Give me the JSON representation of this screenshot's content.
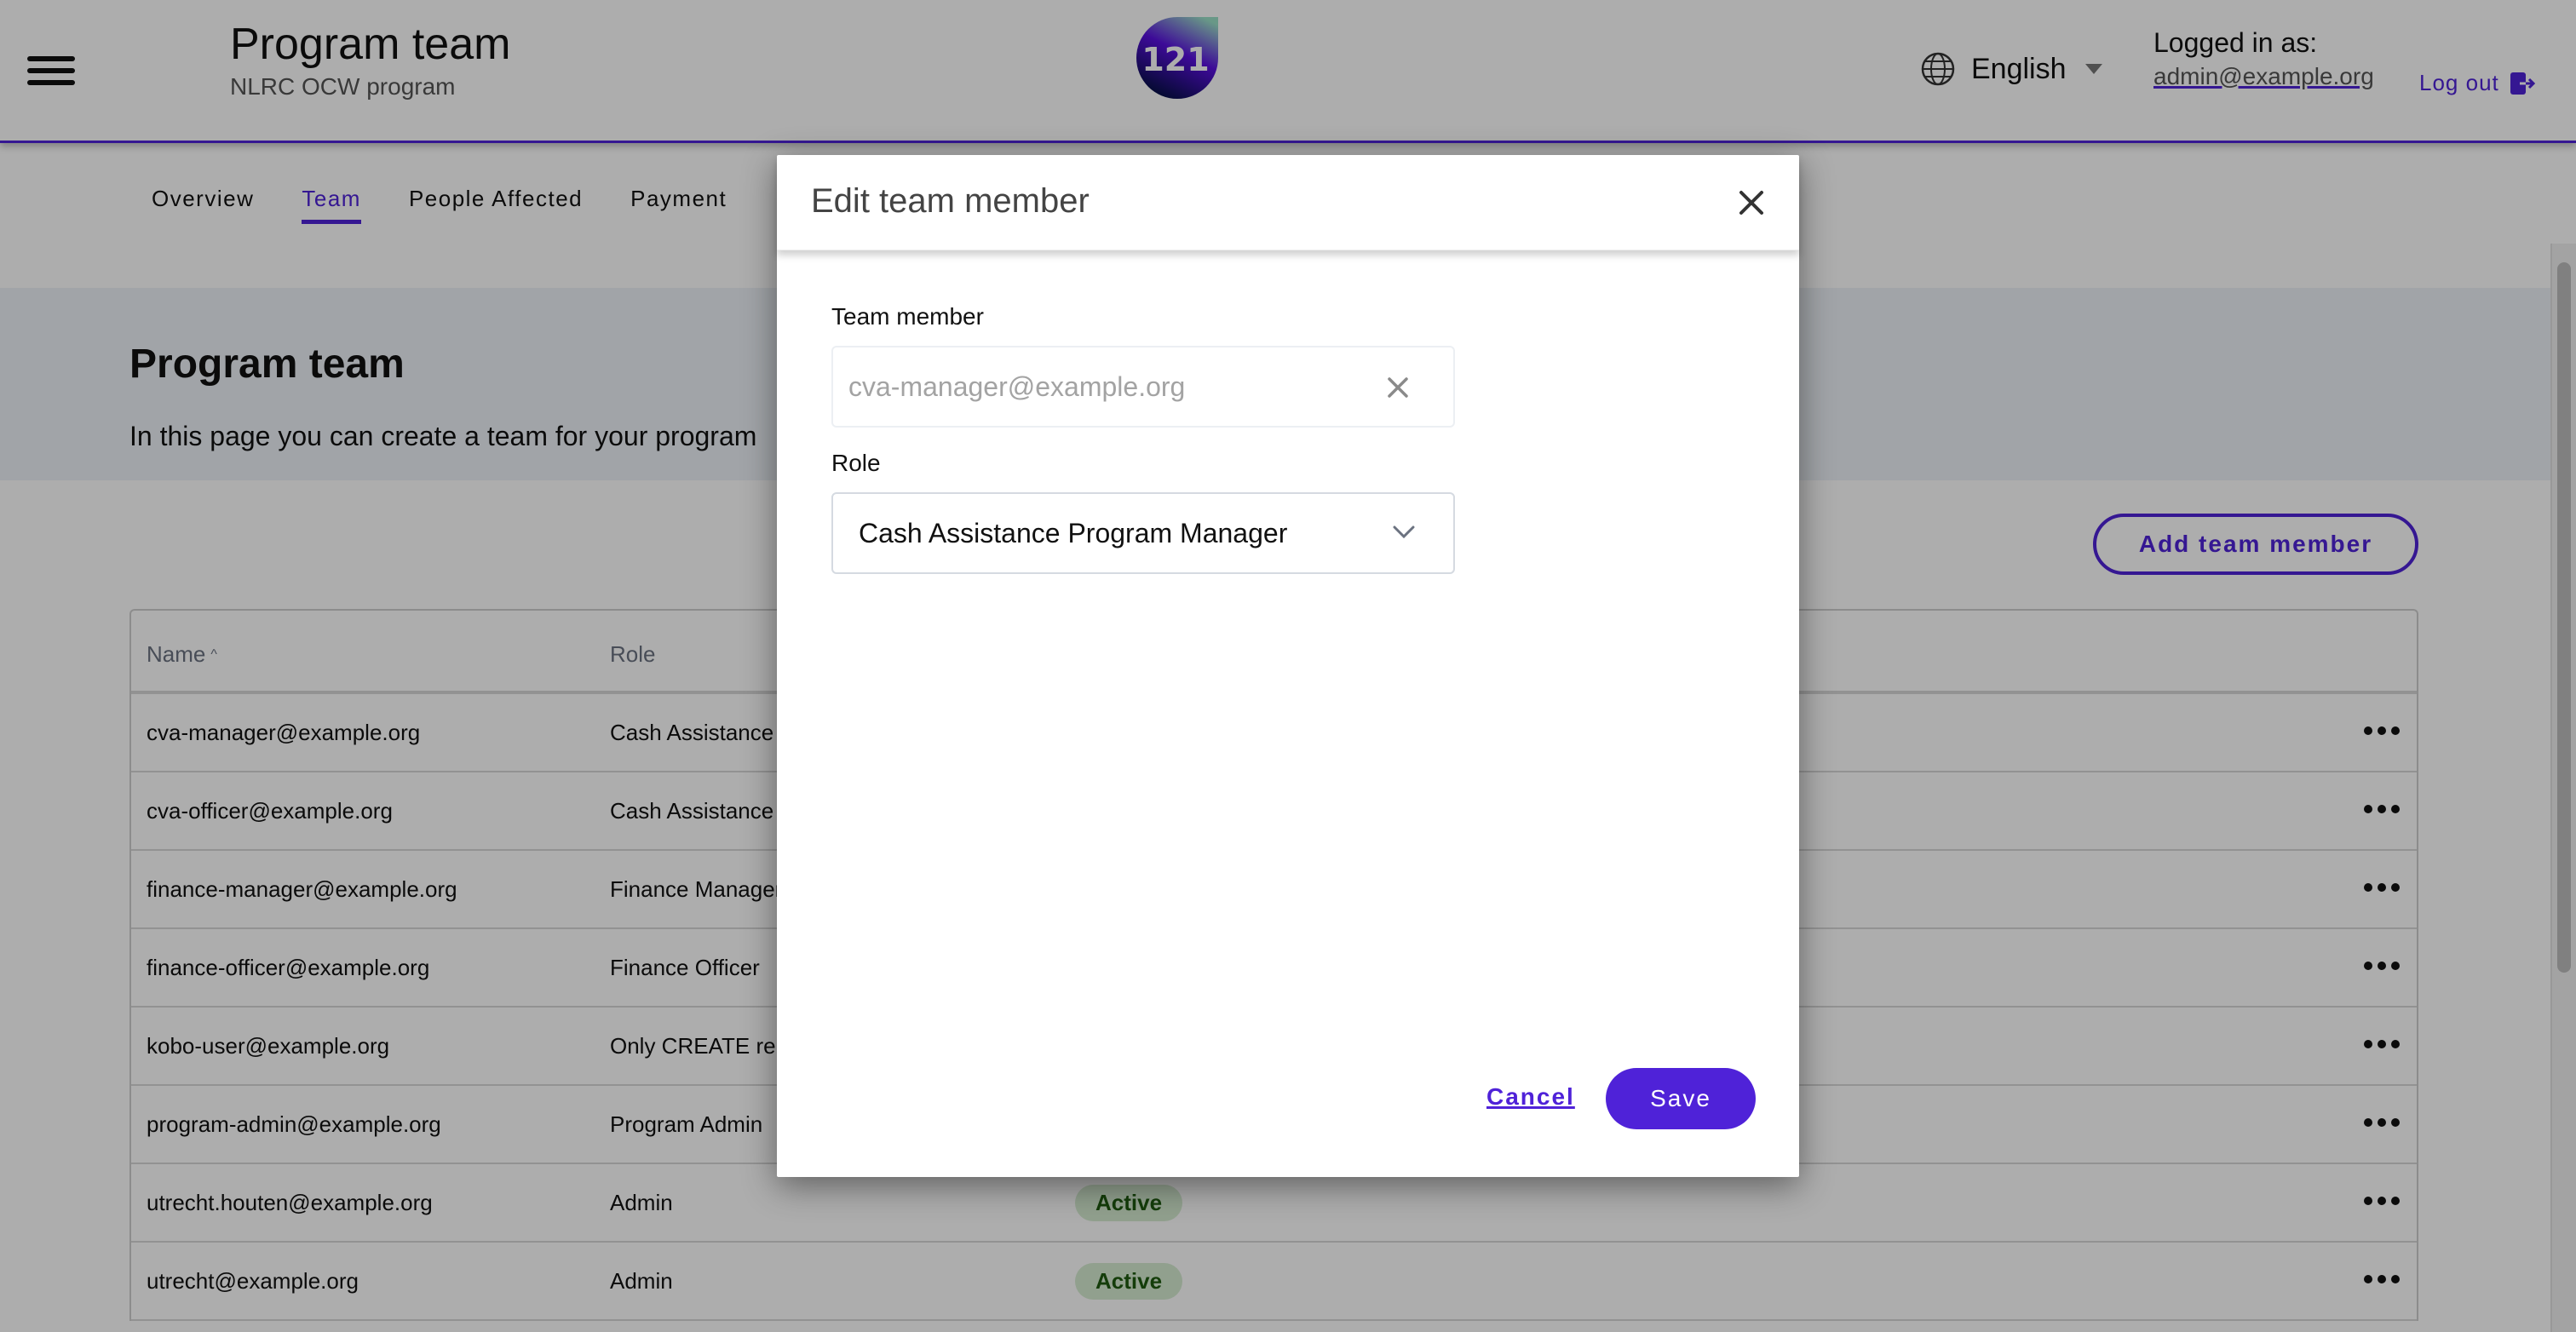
{
  "header": {
    "menu_icon": "hamburger-menu-icon",
    "title": "Program team",
    "subtitle": "NLRC OCW program",
    "logo_text": "121",
    "language": {
      "icon": "globe-icon",
      "selected": "English"
    },
    "logged_in_label": "Logged in as:",
    "logged_in_email": "admin@example.org",
    "logout_label": "Log out",
    "logout_icon": "logout-icon"
  },
  "tabs": [
    {
      "label": "Overview",
      "active": false
    },
    {
      "label": "Team",
      "active": true
    },
    {
      "label": "People Affected",
      "active": false
    },
    {
      "label": "Payment",
      "active": false
    }
  ],
  "page": {
    "title": "Program team",
    "description": "In this page you can create a team for your program",
    "add_button_label": "Add team member"
  },
  "table": {
    "columns": [
      {
        "label": "Name",
        "sort": "ascending",
        "sort_icon": "caret-up-icon"
      },
      {
        "label": "Role"
      }
    ],
    "rows": [
      {
        "name": "cva-manager@example.org",
        "role": "Cash Assistance",
        "status": ""
      },
      {
        "name": "cva-officer@example.org",
        "role": "Cash Assistance",
        "status": ""
      },
      {
        "name": "finance-manager@example.org",
        "role": "Finance Manager",
        "status": ""
      },
      {
        "name": "finance-officer@example.org",
        "role": "Finance Officer",
        "status": ""
      },
      {
        "name": "kobo-user@example.org",
        "role": "Only CREATE re",
        "status": ""
      },
      {
        "name": "program-admin@example.org",
        "role": "Program Admin",
        "status": ""
      },
      {
        "name": "utrecht.houten@example.org",
        "role": "Admin",
        "status": "Active"
      },
      {
        "name": "utrecht@example.org",
        "role": "Admin",
        "status": "Active"
      }
    ],
    "row_action_icon": "more-horizontal-icon"
  },
  "modal": {
    "title": "Edit team member",
    "close_icon": "close-icon",
    "team_member_label": "Team member",
    "team_member_placeholder": "cva-manager@example.org",
    "clear_icon": "clear-icon",
    "role_label": "Role",
    "role_value": "Cash Assistance Program Manager",
    "role_chevron": "chevron-down-icon",
    "cancel_label": "Cancel",
    "save_label": "Save"
  },
  "colors": {
    "accent": "#4f22d8",
    "badge_bg": "#d6ecd2",
    "badge_text": "#1e5a10",
    "hero_bg": "#edf2f8"
  }
}
